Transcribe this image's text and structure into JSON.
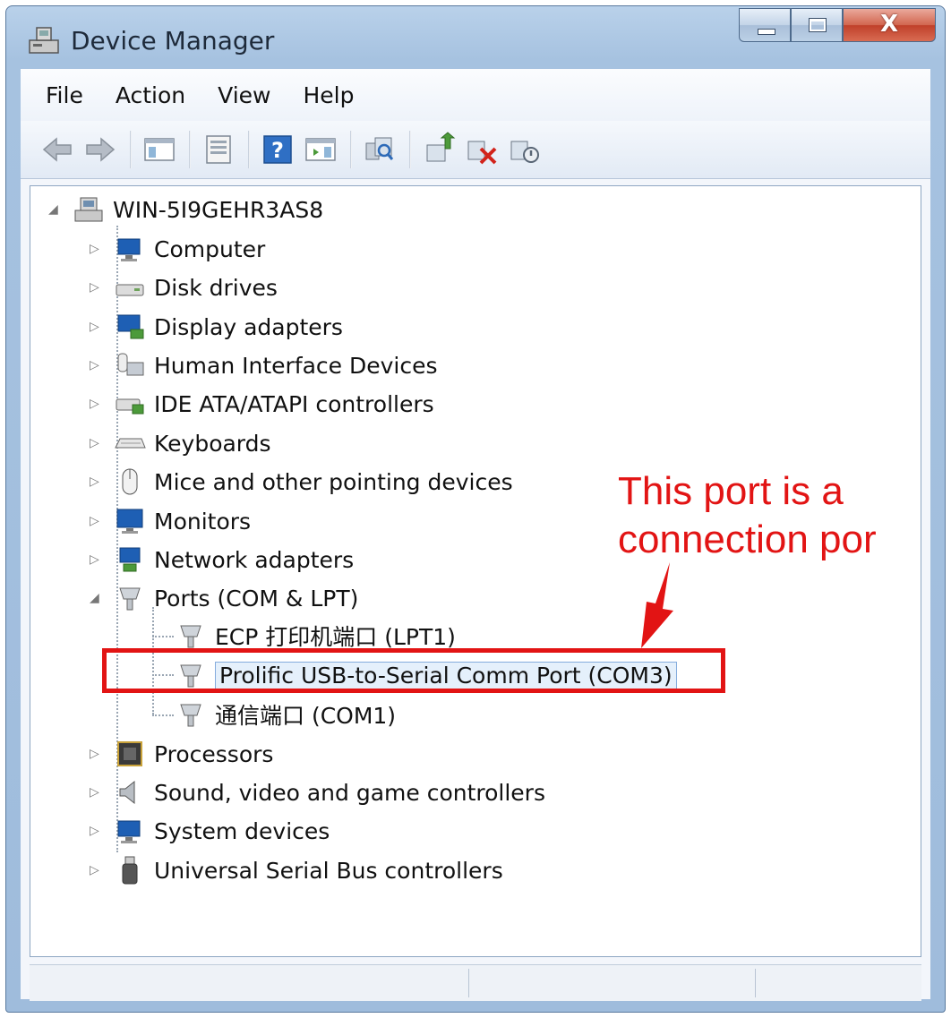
{
  "window": {
    "title": "Device Manager",
    "minimize_glyph": "minimize-icon",
    "maximize_glyph": "maximize-icon",
    "close_glyph": "X"
  },
  "menu": [
    "File",
    "Action",
    "View",
    "Help"
  ],
  "toolbar": {
    "buttons": [
      "back-icon",
      "forward-icon",
      "show-hide-console-tree-icon",
      "properties-icon",
      "help-icon",
      "show-hide-action-pane-icon",
      "scan-hardware-icon",
      "update-driver-icon",
      "uninstall-icon",
      "disable-device-icon"
    ]
  },
  "tree": {
    "root": "WIN-5I9GEHR3AS8",
    "categories": [
      {
        "label": "Computer",
        "icon": "computer-icon"
      },
      {
        "label": "Disk drives",
        "icon": "disk-drive-icon"
      },
      {
        "label": "Display adapters",
        "icon": "display-adapter-icon"
      },
      {
        "label": "Human Interface Devices",
        "icon": "hid-icon"
      },
      {
        "label": "IDE ATA/ATAPI controllers",
        "icon": "ide-controller-icon"
      },
      {
        "label": "Keyboards",
        "icon": "keyboard-icon"
      },
      {
        "label": "Mice and other pointing devices",
        "icon": "mouse-icon"
      },
      {
        "label": "Monitors",
        "icon": "monitor-icon"
      },
      {
        "label": "Network adapters",
        "icon": "network-adapter-icon"
      },
      {
        "label": "Ports (COM & LPT)",
        "icon": "port-icon"
      },
      {
        "label": "Processors",
        "icon": "processor-icon"
      },
      {
        "label": "Sound, video and game controllers",
        "icon": "speaker-icon"
      },
      {
        "label": "System devices",
        "icon": "system-devices-icon"
      },
      {
        "label": "Universal Serial Bus controllers",
        "icon": "usb-icon"
      }
    ],
    "ports_children": [
      "ECP 打印机端口 (LPT1)",
      "Prolific USB-to-Serial Comm Port (COM3)",
      "通信端口 (COM1)"
    ]
  },
  "annotation": {
    "line1": "This port is a",
    "line2": "connection por",
    "color": "#e21414"
  }
}
